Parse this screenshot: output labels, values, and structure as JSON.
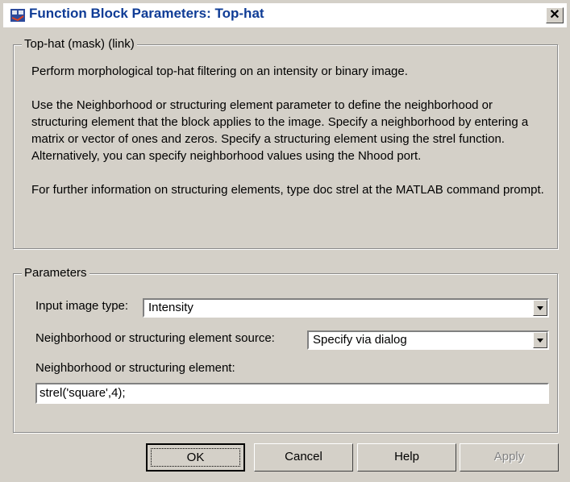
{
  "window": {
    "title": "Function Block Parameters: Top-hat",
    "close_glyph": "✕"
  },
  "mask_group": {
    "legend": "Top-hat (mask) (link)",
    "paragraphs": [
      "Perform morphological top-hat filtering on an intensity or binary image.",
      "Use the Neighborhood or structuring element parameter to define the neighborhood or structuring element that the block applies to the image.  Specify a neighborhood by entering a matrix or vector of ones and zeros.  Specify a structuring element using the strel function.  Alternatively, you can specify neighborhood values using the Nhood port.",
      "For further information on structuring elements, type doc strel at the MATLAB command prompt."
    ]
  },
  "parameters_group": {
    "legend": "Parameters",
    "input_image_type": {
      "label": "Input image type:",
      "value": "Intensity"
    },
    "nhood_source": {
      "label": "Neighborhood or structuring element source:",
      "value": "Specify via dialog"
    },
    "nhood": {
      "label": "Neighborhood or structuring element:",
      "value": "strel('square',4);"
    }
  },
  "buttons": {
    "ok": "OK",
    "cancel": "Cancel",
    "help": "Help",
    "apply": "Apply"
  },
  "icons": {
    "title_icon": "simulink-block-icon",
    "dropdown": "chevron-down-icon"
  }
}
